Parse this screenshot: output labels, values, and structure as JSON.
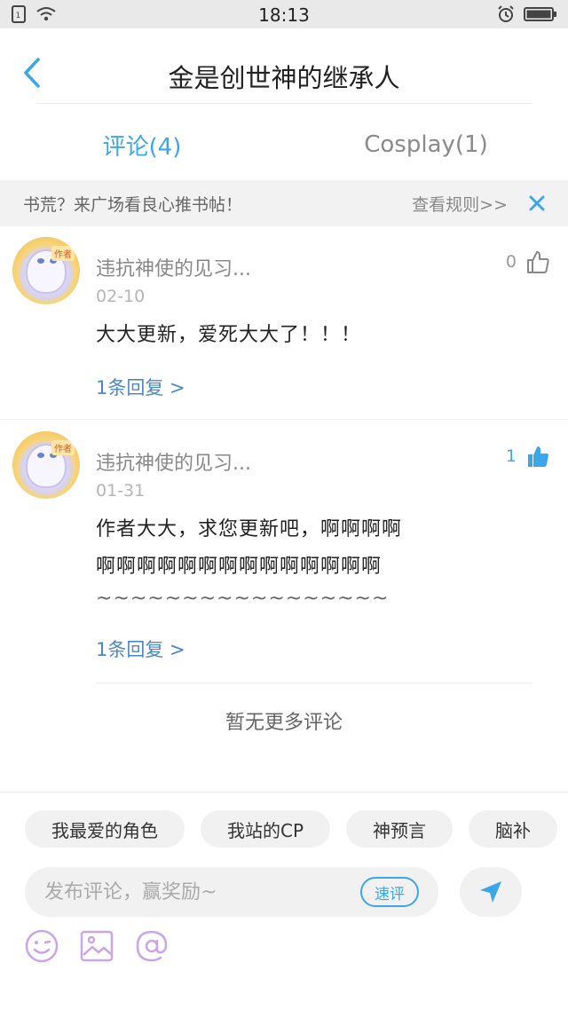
{
  "status_bar": {
    "time": "18:13"
  },
  "header": {
    "title": "金是创世神的继承人"
  },
  "tabs": [
    {
      "label": "评论(4)",
      "active": true
    },
    {
      "label": "Cosplay(1)",
      "active": false
    }
  ],
  "notice": {
    "text": "书荒？来广场看良心推书帖！",
    "rules_link": "查看规则>>"
  },
  "comments": [
    {
      "user": "违抗神使的见习...",
      "date": "02-10",
      "text": "大大更新，爱死大大了！！！",
      "reply": "1条回复 >",
      "likes": "0",
      "liked": false
    },
    {
      "user": "违抗神使的见习...",
      "date": "01-31",
      "text_lines": [
        "作者大大，求您更新吧，啊啊啊啊",
        "啊啊啊啊啊啊啊啊啊啊啊啊啊啊",
        "~~~~~~~~~~~~~~~~~"
      ],
      "reply": "1条回复 >",
      "likes": "1",
      "liked": true
    }
  ],
  "no_more_text": "暂无更多评论",
  "composer": {
    "chips": [
      "我最爱的角色",
      "我站的CP",
      "神预言",
      "脑补"
    ],
    "placeholder": "发布评论，赢奖励~",
    "quick_label": "速评"
  },
  "colors": {
    "accent": "#3ca7e8",
    "reply_link": "#4d87c7",
    "tool_icon": "#c7a6ea"
  },
  "avatar_badge": "作者"
}
